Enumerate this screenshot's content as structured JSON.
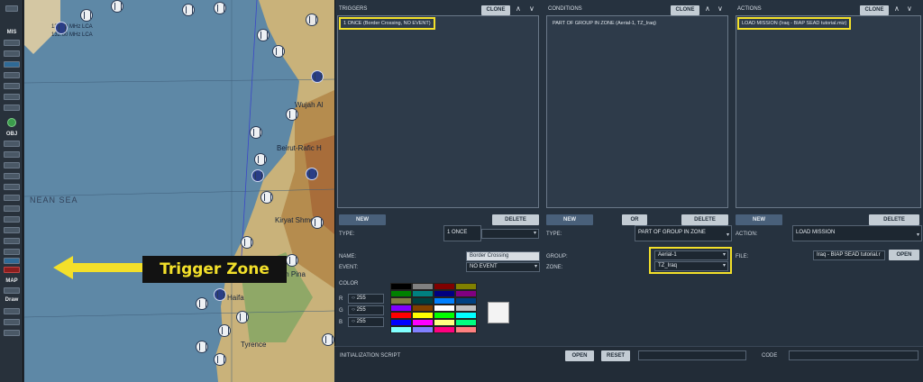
{
  "toolbar": {
    "mis_label": "MIS",
    "obj_label": "OBJ",
    "map_label": "MAP",
    "draw_label": "Draw"
  },
  "map": {
    "labels": {
      "sea_label": "NEAN SEA",
      "wujah": "Wujah Al",
      "beirut": "Beirut-Rafic H",
      "kiryat": "Kiryat Shmo",
      "haifa": "Haifa",
      "pina": "Rosh Pina",
      "tyrence": "Tyrence",
      "freq1": "132.60 MHz LCA",
      "freq2": "132.60 MHz LCA"
    },
    "callout": "Trigger Zone"
  },
  "triggers": {
    "header": "TRIGGERS",
    "clone_label": "CLONE",
    "item": "1 ONCE (Border Crossing, NO EVENT)",
    "new_label": "NEW",
    "delete_label": "DELETE",
    "type_label": "TYPE:",
    "type_value": "1 ONCE",
    "name_label": "NAME:",
    "name_value": "Border Crossing",
    "event_label": "EVENT:",
    "event_value": "NO EVENT",
    "color_label": "COLOR",
    "r_label": "R",
    "g_label": "G",
    "b_label": "B",
    "r_value": "255",
    "g_value": "255",
    "b_value": "255"
  },
  "conditions": {
    "header": "CONDITIONS",
    "clone_label": "CLONE",
    "item": "PART OF GROUP IN ZONE (Aerial-1, TZ_Iraq)",
    "new_label": "NEW",
    "or_label": "OR",
    "delete_label": "DELETE",
    "type_label": "TYPE:",
    "type_value": "PART OF GROUP IN ZONE",
    "group_label": "GROUP:",
    "group_value": "Aerial-1",
    "zone_label": "ZONE:",
    "zone_value": "TZ_Iraq"
  },
  "actions": {
    "header": "ACTIONS",
    "clone_label": "CLONE",
    "item": "LOAD MISSION (Iraq - BIAP SEAD tutorial.miz)",
    "new_label": "NEW",
    "delete_label": "DELETE",
    "action_label": "ACTION:",
    "action_value": "LOAD MISSION",
    "file_label": "FILE:",
    "file_value": "Iraq - BIAP SEAD tutorial.r",
    "open_label": "OPEN"
  },
  "bottom": {
    "init_label": "INITIALIZATION SCRIPT",
    "open_label": "OPEN",
    "reset_label": "RESET",
    "code_label": "CODE"
  },
  "colors": {
    "highlight": "#f3e02a",
    "palette": [
      "#000000",
      "#808080",
      "#800000",
      "#808000",
      "#008000",
      "#008080",
      "#000080",
      "#800080",
      "#808040",
      "#004040",
      "#0080ff",
      "#004080",
      "#8000ff",
      "#804000",
      "#ffffff",
      "#c0c0c0",
      "#ff0000",
      "#ffff00",
      "#00ff00",
      "#00ffff",
      "#0000ff",
      "#ff00ff",
      "#ffff80",
      "#00ff80",
      "#80ffff",
      "#8080ff",
      "#ff0080",
      "#ff8080"
    ]
  }
}
